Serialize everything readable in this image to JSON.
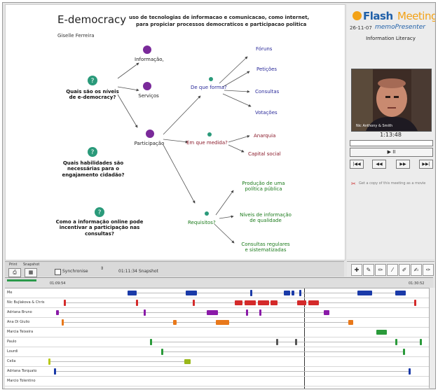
{
  "slide": {
    "title": "E-democracy",
    "author": "Giselle Ferreira",
    "subtitle_line1": "uso de tecnologias de informacao e comunicacao, como internet,",
    "subtitle_line2": "para propiciar processos democraticos e participacao politica",
    "q1": [
      "Quais são os níveis",
      "de e-democracy?"
    ],
    "q2": [
      "Quais habilidades são",
      "necessárias para o",
      "engajamento cidadão?"
    ],
    "q3": [
      "Como a informação online pode",
      "incentivar a participação nas",
      "consultas?"
    ],
    "n1": "Informação,",
    "n2": "Serviços",
    "n3": "Participação",
    "b_hub": "De que forma?",
    "b_items": [
      "Fóruns",
      "Petições",
      "Consultas",
      "Votações"
    ],
    "r_hub": "Em que medida?",
    "r_items": [
      "Anarquia",
      "Capital social"
    ],
    "g_hub": "Requisitos?",
    "g_item1": [
      "Produção de uma",
      "política pública"
    ],
    "g_item2": [
      "Níveis de informação",
      "de qualidade"
    ],
    "g_item3": [
      "Consultas regulares",
      "e sistematizadas"
    ]
  },
  "right": {
    "logo_flash": "Flash",
    "logo_meeting": "Meeting",
    "logo_date": "26-11-07",
    "logo_memo": "memoPresenter",
    "subtitle": "Information Literacy",
    "video_label": "Nic Anthony & Smith",
    "timecode": "1:13:48",
    "play_label": "▶  II",
    "nav": [
      "|◀◀",
      "◀◀",
      "▶▶",
      "▶▶|"
    ],
    "link_text": "Get a copy of this meeting as a movie"
  },
  "controls": {
    "print_label": "Print",
    "snapshot_label": "Snapshot",
    "sync_label": "Synchronise",
    "time_label": "01:11:34  Snapshot"
  },
  "timeline": {
    "start_time": "01:09:54",
    "end_time": "01:30:52",
    "rows": [
      {
        "name": "Me",
        "marks": [
          {
            "a": 0.21,
            "w": 0.025,
            "c": "#1a3aa8"
          },
          {
            "a": 0.365,
            "w": 0.03,
            "c": "#1a3aa8"
          },
          {
            "a": 0.535,
            "w": 0.004,
            "c": "#1a3aa8"
          },
          {
            "a": 0.625,
            "w": 0.016,
            "c": "#1a3aa8"
          },
          {
            "a": 0.645,
            "w": 0.008,
            "c": "#1a3aa8"
          },
          {
            "a": 0.666,
            "w": 0.004,
            "c": "#1a3aa8"
          },
          {
            "a": 0.82,
            "w": 0.038,
            "c": "#1a3aa8"
          },
          {
            "a": 0.92,
            "w": 0.028,
            "c": "#1a3aa8"
          }
        ]
      },
      {
        "name": "Nic Bujlakova & Chris",
        "marks": [
          {
            "a": 0.04,
            "w": 0.004,
            "c": "#d42a2a"
          },
          {
            "a": 0.232,
            "w": 0.004,
            "c": "#d42a2a"
          },
          {
            "a": 0.382,
            "w": 0.004,
            "c": "#d42a2a"
          },
          {
            "a": 0.495,
            "w": 0.02,
            "c": "#d42a2a"
          },
          {
            "a": 0.52,
            "w": 0.03,
            "c": "#d42a2a"
          },
          {
            "a": 0.555,
            "w": 0.03,
            "c": "#d42a2a"
          },
          {
            "a": 0.59,
            "w": 0.018,
            "c": "#d42a2a"
          },
          {
            "a": 0.66,
            "w": 0.024,
            "c": "#d42a2a"
          },
          {
            "a": 0.69,
            "w": 0.028,
            "c": "#d42a2a"
          },
          {
            "a": 0.97,
            "w": 0.004,
            "c": "#d42a2a"
          }
        ]
      },
      {
        "name": "Adriana Bruno",
        "marks": [
          {
            "a": 0.02,
            "w": 0.008,
            "c": "#8a1aa8"
          },
          {
            "a": 0.252,
            "w": 0.004,
            "c": "#8a1aa8"
          },
          {
            "a": 0.42,
            "w": 0.03,
            "c": "#8a1aa8"
          },
          {
            "a": 0.525,
            "w": 0.004,
            "c": "#8a1aa8"
          },
          {
            "a": 0.56,
            "w": 0.004,
            "c": "#8a1aa8"
          },
          {
            "a": 0.73,
            "w": 0.016,
            "c": "#8a1aa8"
          }
        ]
      },
      {
        "name": "Ana Di Giulio",
        "marks": [
          {
            "a": 0.035,
            "w": 0.004,
            "c": "#e8781a"
          },
          {
            "a": 0.33,
            "w": 0.01,
            "c": "#e8781a"
          },
          {
            "a": 0.445,
            "w": 0.035,
            "c": "#e8781a"
          },
          {
            "a": 0.795,
            "w": 0.014,
            "c": "#e8781a"
          }
        ]
      },
      {
        "name": "Marcia Teixeira",
        "marks": [
          {
            "a": 0.87,
            "w": 0.028,
            "c": "#2a9a3a"
          }
        ]
      },
      {
        "name": "Paulo",
        "marks": [
          {
            "a": 0.27,
            "w": 0.004,
            "c": "#2a9a3a"
          },
          {
            "a": 0.605,
            "w": 0.004,
            "c": "#555555"
          },
          {
            "a": 0.655,
            "w": 0.004,
            "c": "#555555"
          },
          {
            "a": 0.92,
            "w": 0.004,
            "c": "#2a9a3a"
          },
          {
            "a": 0.985,
            "w": 0.004,
            "c": "#2a9a3a"
          }
        ]
      },
      {
        "name": "Lourdi",
        "marks": [
          {
            "a": 0.3,
            "w": 0.004,
            "c": "#2a9a3a"
          },
          {
            "a": 0.94,
            "w": 0.004,
            "c": "#2a9a3a"
          }
        ]
      },
      {
        "name": "Celia",
        "marks": [
          {
            "a": 0.0,
            "w": 0.006,
            "c": "#b8c81a"
          },
          {
            "a": 0.36,
            "w": 0.018,
            "c": "#9ab81a"
          }
        ]
      },
      {
        "name": "Adriana Torquato",
        "marks": [
          {
            "a": 0.015,
            "w": 0.004,
            "c": "#1a3aa8"
          },
          {
            "a": 0.955,
            "w": 0.004,
            "c": "#1a3aa8"
          }
        ]
      },
      {
        "name": "Marcio Tolentino",
        "marks": []
      }
    ]
  }
}
